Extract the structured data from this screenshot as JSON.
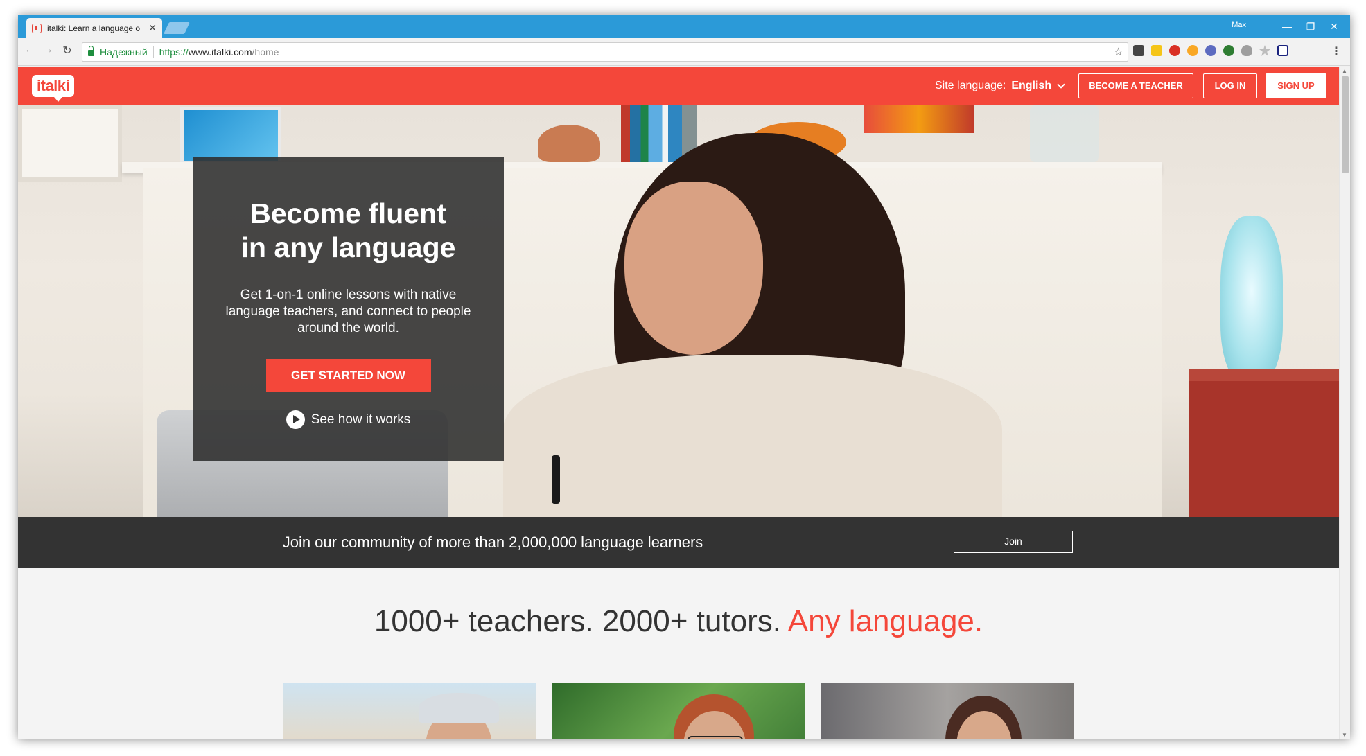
{
  "browser": {
    "tab_title": "italki: Learn a language o",
    "user": "Max",
    "secure_label": "Надежный",
    "url_scheme": "https://",
    "url_host": "www.italki.com",
    "url_path": "/home"
  },
  "header": {
    "logo": "italki",
    "site_language_label": "Site language:",
    "site_language_value": "English",
    "become_teacher": "BECOME A TEACHER",
    "login": "LOG IN",
    "signup": "SIGN UP"
  },
  "hero": {
    "title_line1": "Become fluent",
    "title_line2": "in any language",
    "subtitle": "Get 1-on-1 online lessons with native language teachers, and connect to people around the world.",
    "cta": "GET STARTED NOW",
    "see_how": "See how it works"
  },
  "community": {
    "text": "Join our community of more than 2,000,000 language learners",
    "join": "Join"
  },
  "tagline": {
    "main": "1000+ teachers. 2000+ tutors. ",
    "accent": "Any language."
  },
  "colors": {
    "brand": "#f4473a",
    "dark_strip": "#333333",
    "tab_strip": "#2b9ad8"
  }
}
